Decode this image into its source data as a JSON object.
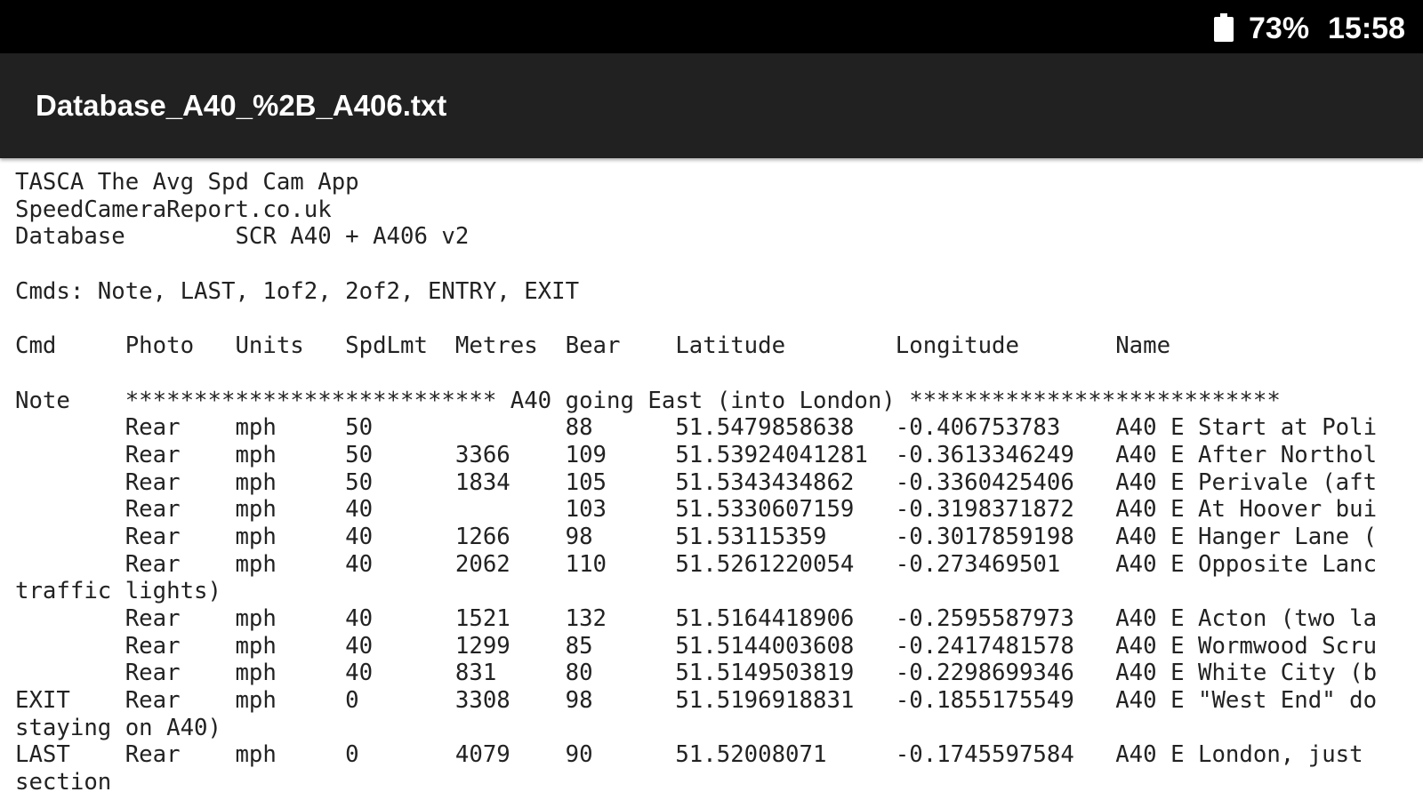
{
  "status_bar": {
    "battery_percent": "73%",
    "time": "15:58",
    "battery_icon": "battery-icon"
  },
  "app_bar": {
    "title": "Database_A40_%2B_A406.txt"
  },
  "document": {
    "lines": [
      "TASCA The Avg Spd Cam App",
      "SpeedCameraReport.co.uk",
      "Database        SCR A40 + A406 v2",
      "",
      "Cmds: Note, LAST, 1of2, 2of2, ENTRY, EXIT",
      "",
      "Cmd     Photo   Units   SpdLmt  Metres  Bear    Latitude        Longitude       Name",
      "",
      "Note    *************************** A40 going East (into London) ***************************",
      "        Rear    mph     50              88      51.5479858638   -0.406753783    A40 E Start at Poli",
      "        Rear    mph     50      3366    109     51.53924041281  -0.3613346249   A40 E After Northol",
      "        Rear    mph     50      1834    105     51.5343434862   -0.3360425406   A40 E Perivale (aft",
      "        Rear    mph     40              103     51.5330607159   -0.3198371872   A40 E At Hoover bui",
      "        Rear    mph     40      1266    98      51.53115359     -0.3017859198   A40 E Hanger Lane (",
      "        Rear    mph     40      2062    110     51.5261220054   -0.273469501    A40 E Opposite Lanc",
      "traffic lights)",
      "        Rear    mph     40      1521    132     51.5164418906   -0.2595587973   A40 E Acton (two la",
      "        Rear    mph     40      1299    85      51.5144003608   -0.2417481578   A40 E Wormwood Scru",
      "        Rear    mph     40      831     80      51.5149503819   -0.2298699346   A40 E White City (b",
      "EXIT    Rear    mph     0       3308    98      51.5196918831   -0.1855175549   A40 E \"West End\" do",
      "staying on A40)",
      "LAST    Rear    mph     0       4079    90      51.52008071     -0.1745597584   A40 E London, just",
      "section"
    ]
  }
}
